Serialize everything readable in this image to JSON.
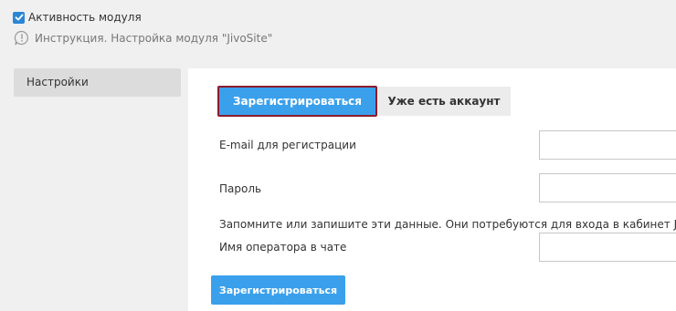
{
  "module": {
    "active_checkbox_label": "Активность модуля",
    "active_checked": true,
    "instruction_text": "Инструкция. Настройка модуля \"JivoSite\""
  },
  "sidebar": {
    "items": [
      {
        "label": "Настройки"
      }
    ]
  },
  "tabs": [
    {
      "label": "Зарегистрироваться",
      "active": true
    },
    {
      "label": "Уже есть аккаунт",
      "active": false
    }
  ],
  "form": {
    "email_label": "E-mail для регистрации",
    "email_value": "",
    "password_label": "Пароль",
    "password_value": "",
    "note": "Запомните или запишите эти данные. Они потребуются для входа в кабинет JivoSite",
    "operator_label": "Имя оператора в чате",
    "operator_value": "",
    "submit_label": "Зарегистрироваться"
  },
  "colors": {
    "accent": "#3aa0ec",
    "checkbox": "#2b86d6",
    "active_tab_border": "#8b1c2b"
  }
}
